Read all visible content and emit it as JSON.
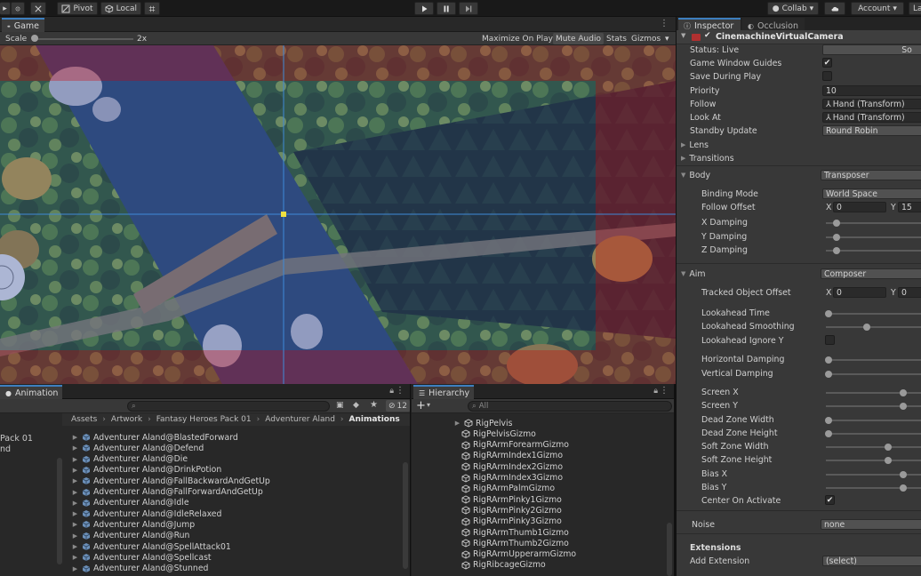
{
  "toolbar": {
    "pivot_label": "Pivot",
    "local_label": "Local",
    "collab_label": "Collab",
    "account_label": "Account",
    "layers_label": "La"
  },
  "game_view": {
    "tab_label": "Game",
    "scale_label": "Scale",
    "scale_value": "2x",
    "maximize_label": "Maximize On Play",
    "mute_label": "Mute Audio",
    "stats_label": "Stats",
    "gizmos_label": "Gizmos"
  },
  "animation_panel": {
    "tab_label": "Animation",
    "badge_count": "12",
    "folders": [
      "Pack 01",
      "nd"
    ],
    "breadcrumb": [
      "Assets",
      "Artwork",
      "Fantasy Heroes Pack 01",
      "Adventurer Aland",
      "Animations"
    ],
    "items": [
      "Adventurer Aland@BlastedForward",
      "Adventurer Aland@Defend",
      "Adventurer Aland@Die",
      "Adventurer Aland@DrinkPotion",
      "Adventurer Aland@FallBackwardAndGetUp",
      "Adventurer Aland@FallForwardAndGetUp",
      "Adventurer Aland@Idle",
      "Adventurer Aland@IdleRelaxed",
      "Adventurer Aland@Jump",
      "Adventurer Aland@Run",
      "Adventurer Aland@SpellAttack01",
      "Adventurer Aland@Spellcast",
      "Adventurer Aland@Stunned"
    ]
  },
  "hierarchy_panel": {
    "tab_label": "Hierarchy",
    "search_placeholder": "All",
    "items": [
      "RigPelvis",
      "RigPelvisGizmo",
      "RigRArmForearmGizmo",
      "RigRArmIndex1Gizmo",
      "RigRArmIndex2Gizmo",
      "RigRArmIndex3Gizmo",
      "RigRArmPalmGizmo",
      "RigRArmPinky1Gizmo",
      "RigRArmPinky2Gizmo",
      "RigRArmPinky3Gizmo",
      "RigRArmThumb1Gizmo",
      "RigRArmThumb2Gizmo",
      "RigRArmUpperarmGizmo",
      "RigRibcageGizmo"
    ]
  },
  "inspector": {
    "tab_label": "Inspector",
    "occlusion_label": "Occlusion",
    "component_title": "CinemachineVirtualCamera",
    "status_label": "Status: Live",
    "solo_label": "So",
    "game_window_guides_label": "Game Window Guides",
    "save_during_play_label": "Save During Play",
    "priority_label": "Priority",
    "priority_value": "10",
    "follow_label": "Follow",
    "follow_value": "Hand (Transform)",
    "look_at_label": "Look At",
    "look_at_value": "Hand (Transform)",
    "standby_label": "Standby Update",
    "standby_value": "Round Robin",
    "lens_label": "Lens",
    "transitions_label": "Transitions",
    "body_label": "Body",
    "body_value": "Transposer",
    "binding_mode_label": "Binding Mode",
    "binding_mode_value": "World Space",
    "follow_offset_label": "Follow Offset",
    "follow_offset_x": "0",
    "follow_offset_y": "15",
    "x_damping_label": "X Damping",
    "y_damping_label": "Y Damping",
    "z_damping_label": "Z Damping",
    "aim_label": "Aim",
    "aim_value": "Composer",
    "tracked_offset_label": "Tracked Object Offset",
    "tracked_offset_x": "0",
    "tracked_offset_y": "0",
    "lookahead_time_label": "Lookahead Time",
    "lookahead_smoothing_label": "Lookahead Smoothing",
    "lookahead_ignore_y_label": "Lookahead Ignore Y",
    "horizontal_damping_label": "Horizontal Damping",
    "vertical_damping_label": "Vertical Damping",
    "screen_x_label": "Screen X",
    "screen_y_label": "Screen Y",
    "dead_zone_width_label": "Dead Zone Width",
    "dead_zone_height_label": "Dead Zone Height",
    "soft_zone_width_label": "Soft Zone Width",
    "soft_zone_height_label": "Soft Zone Height",
    "bias_x_label": "Bias X",
    "bias_y_label": "Bias Y",
    "center_on_activate_label": "Center On Activate",
    "noise_label": "Noise",
    "noise_value": "none",
    "extensions_label": "Extensions",
    "add_extension_label": "Add Extension",
    "add_extension_value": "(select)",
    "axis_x": "X",
    "axis_y": "Y"
  },
  "colors": {
    "tab_accent": "#3d7fbf",
    "panel_bg": "#383838",
    "dead_zone_tint": "#2d4aa0",
    "soft_zone_tint": "#8c1e46"
  }
}
